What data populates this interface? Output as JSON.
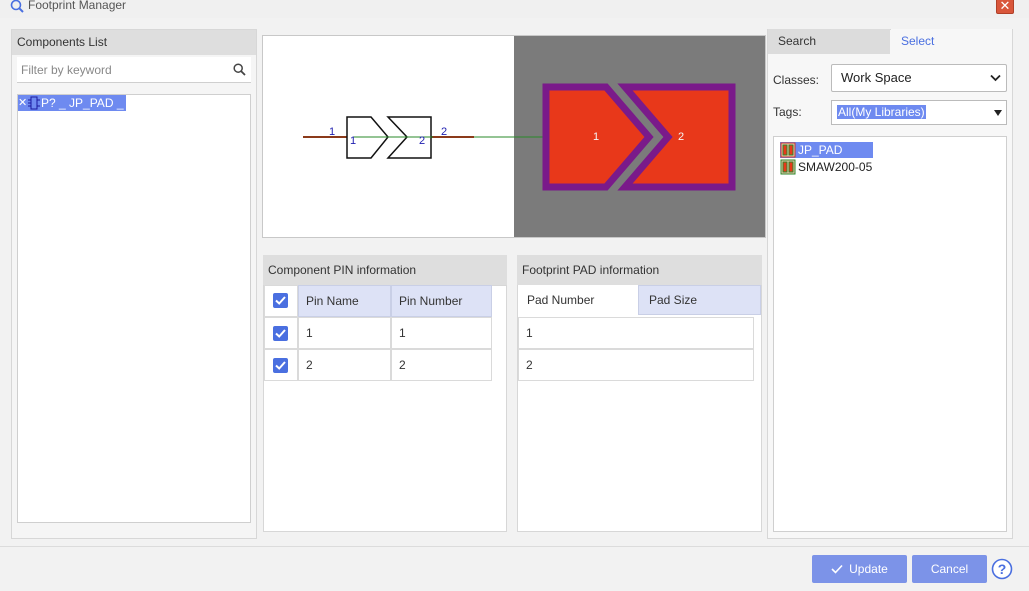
{
  "window": {
    "title": "Footprint Manager",
    "close_label": "✕"
  },
  "components": {
    "header": "Components List",
    "filter_placeholder": "Filter by keyword",
    "items": [
      {
        "label": "P? _ JP_PAD _",
        "remove": "✕"
      }
    ]
  },
  "preview": {
    "symbol_pins": [
      "1",
      "1",
      "2",
      "2"
    ],
    "pads": [
      "1",
      "2"
    ]
  },
  "pin_info": {
    "header": "Component PIN information",
    "columns": [
      "Pin Name",
      "Pin Number"
    ],
    "rows": [
      {
        "name": "1",
        "number": "1",
        "checked": true
      },
      {
        "name": "2",
        "number": "2",
        "checked": true
      }
    ],
    "header_checked": true
  },
  "pad_info": {
    "header": "Footprint PAD information",
    "columns": [
      "Pad Number",
      "Pad Size"
    ],
    "rows": [
      {
        "number": "1"
      },
      {
        "number": "2"
      }
    ]
  },
  "right": {
    "tabs": [
      "Search",
      "Select"
    ],
    "classes_label": "Classes:",
    "classes_value": "Work Space",
    "tags_label": "Tags:",
    "tags_value": "All(My Libraries)",
    "libraries": [
      {
        "name": "JP_PAD",
        "selected": true
      },
      {
        "name": "SMAW200-05",
        "selected": false
      }
    ]
  },
  "buttons": {
    "update": "Update",
    "cancel": "Cancel",
    "help": "?"
  },
  "colors": {
    "accent": "#6e8af0",
    "pad_fill": "#e8381a",
    "pad_outline": "#7a1a8a",
    "pcb_bg": "#7b7b7b"
  }
}
